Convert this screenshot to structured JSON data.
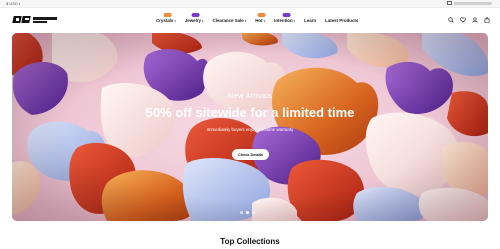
{
  "topbar": {
    "currency": "$ USD",
    "email_hidden": "blurred email address"
  },
  "nav": {
    "items": [
      {
        "label": "Crystals",
        "has_dropdown": true,
        "badge": "orange"
      },
      {
        "label": "Jewelry",
        "has_dropdown": true,
        "badge": "purple"
      },
      {
        "label": "Clearance Sale",
        "has_dropdown": true,
        "badge": null
      },
      {
        "label": "Hot",
        "has_dropdown": true,
        "badge": "orange"
      },
      {
        "label": "Intention",
        "has_dropdown": true,
        "badge": "purple"
      },
      {
        "label": "Learn",
        "has_dropdown": false,
        "badge": null
      },
      {
        "label": "Latest Products",
        "has_dropdown": false,
        "badge": null
      }
    ]
  },
  "header_icons": [
    "search-icon",
    "heart-icon",
    "user-icon",
    "bag-icon"
  ],
  "hero": {
    "subtitle": "New Arrivals",
    "title": "50% off sitewide for a limited time",
    "description": "Immediately buyers enjoy a lifetime warranty",
    "button": "Check Details",
    "slides": 3,
    "active_slide": 1
  },
  "section": {
    "title": "Top Collections"
  },
  "colors": {
    "badge_orange": "#f08a3c",
    "badge_purple": "#7b39c9",
    "hero_bg": "#f3d9e2"
  }
}
